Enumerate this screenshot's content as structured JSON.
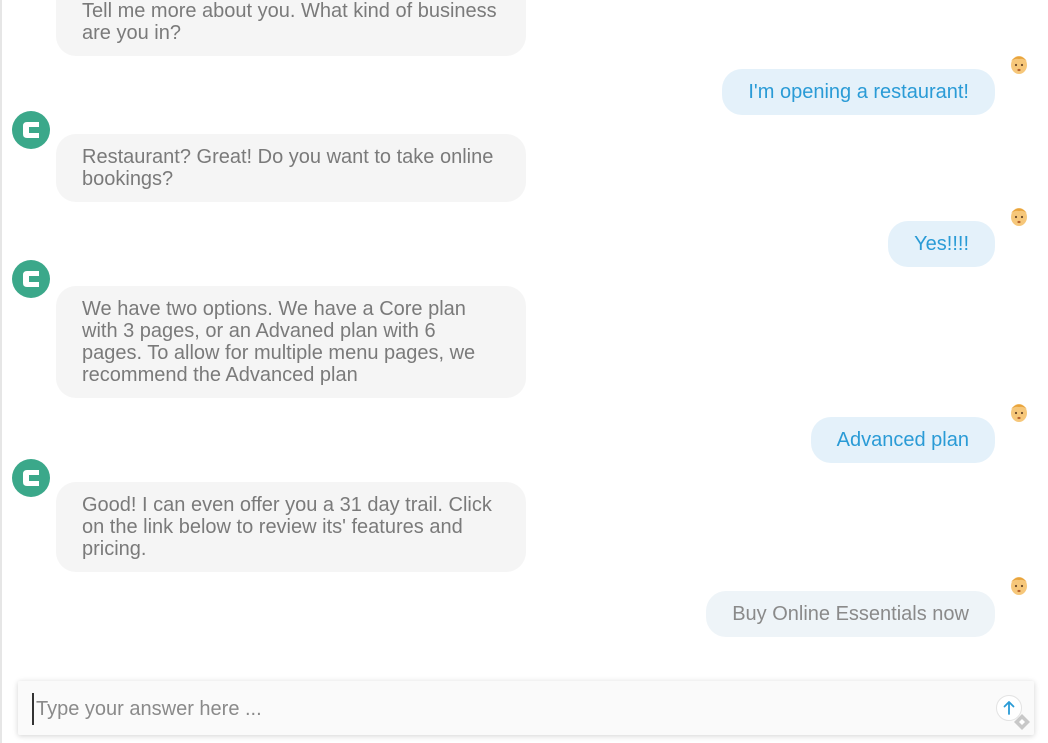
{
  "messages": [
    {
      "from": "bot",
      "text": "Tell me more about you. What kind of business are you in?"
    },
    {
      "from": "user",
      "text": "I'm opening a restaurant!"
    },
    {
      "from": "bot",
      "text": "Restaurant? Great! Do you want to take online bookings?"
    },
    {
      "from": "user",
      "text": "Yes!!!!"
    },
    {
      "from": "bot",
      "text": "We have two options. We have a Core plan with 3 pages, or an Advaned plan with 6 pages. To allow for multiple menu pages, we recommend the Advanced plan"
    },
    {
      "from": "user",
      "text": "Advanced plan"
    },
    {
      "from": "bot",
      "text": "Good! I can even offer you a 31 day trail. Click on the link below to review its' features and pricing."
    },
    {
      "from": "user",
      "text": "Buy Online Essentials now"
    }
  ],
  "input": {
    "placeholder": "Type your answer here ...",
    "value": ""
  },
  "icons": {
    "bot_avatar": "bot-logo-icon",
    "user_avatar": "user-face-icon",
    "send": "arrow-up-icon"
  },
  "colors": {
    "bot_avatar": "#3ba88a",
    "user_bubble_bg": "#e4f1fa",
    "user_text": "#2a9bd6",
    "bot_bubble_bg": "#f5f5f5",
    "bot_text": "#7a7a7a"
  }
}
